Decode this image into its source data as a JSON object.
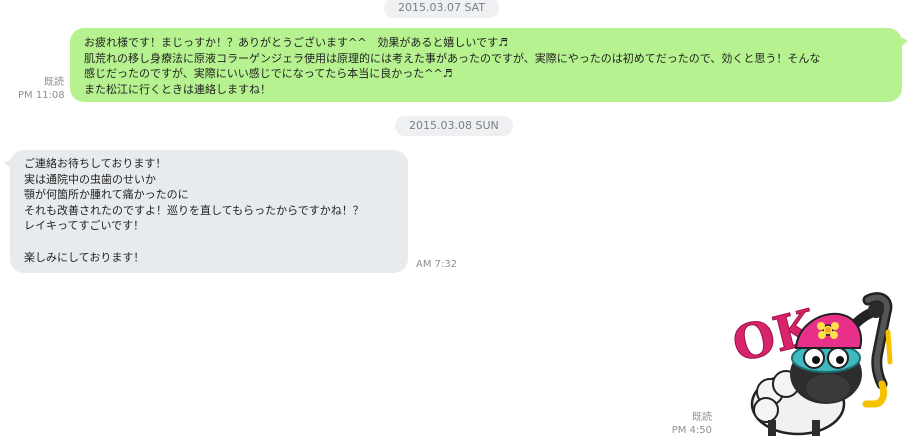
{
  "chat": {
    "date1": "2015.03.07 SAT",
    "date2": "2015.03.08 SUN",
    "msg_out": {
      "read_label": "既読",
      "time": "PM 11:08",
      "lines": [
        "お疲れ様です！まじっすか！？ありがとうございます^^　効果があると嬉しいです♬",
        "肌荒れの移し身療法に原液コラーゲンジェラ使用は原理的には考えた事があったのですが、実際にやったのは初めてだったので、効くと思う！そんな",
        "感じだったのですが、実際にいい感じでになってたら本当に良かった^^♬",
        "また松江に行くときは連絡しますね！"
      ]
    },
    "msg_in": {
      "time": "AM 7:32",
      "lines": [
        "ご連絡お待ちしております！",
        "実は通院中の虫歯のせいか",
        "顎が何箇所か腫れて痛かったのに",
        "それも改善されたのですよ！巡りを直してもらったからですかね！？",
        "レイキってすごいです！",
        "",
        "楽しみにしております！"
      ]
    },
    "sticker": {
      "text": "OK",
      "read_label": "既読",
      "time": "PM 4:50",
      "icon": "sheep-snorkel-ok-sticker"
    }
  }
}
